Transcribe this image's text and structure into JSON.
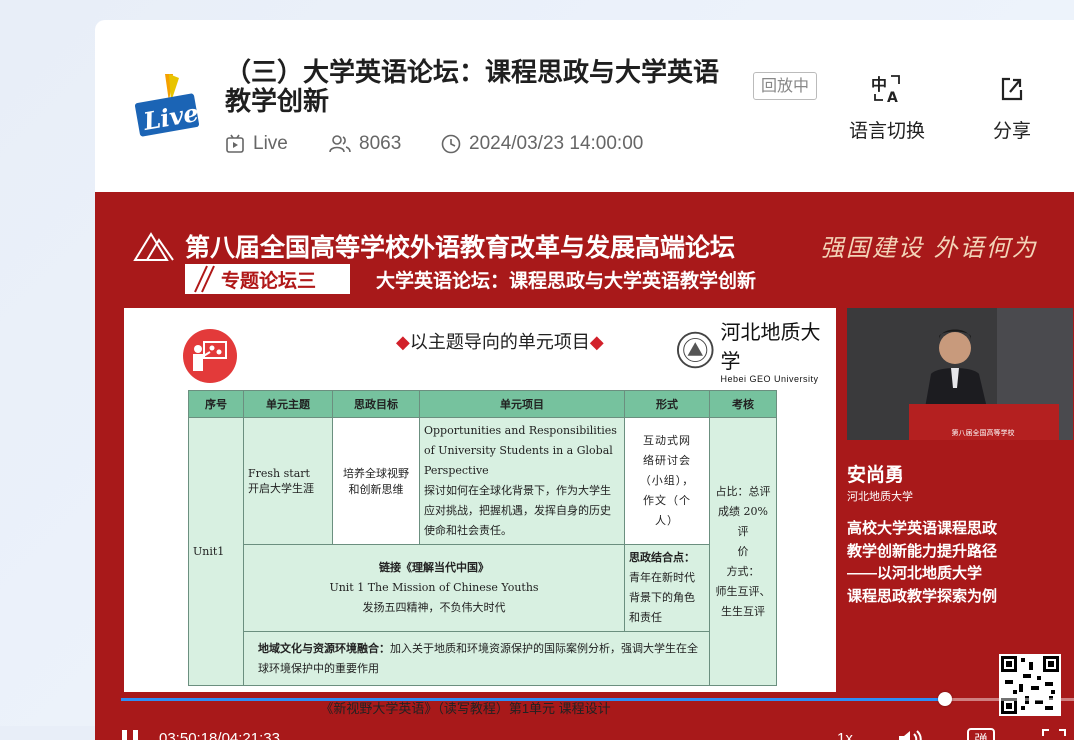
{
  "header": {
    "logo_text": "Live",
    "title": "（三）大学英语论坛：课程思政与大学英语教学创新",
    "status_badge": "回放中",
    "type_label": "Live",
    "viewers": "8063",
    "datetime": "2024/03/23 14:00:00",
    "tools": [
      {
        "label": "语言切换",
        "icon": "language-switch-icon"
      },
      {
        "label": "分享",
        "icon": "share-icon"
      }
    ]
  },
  "video": {
    "forum_title": "第八届全国高等学校外语教育改革与发展高端论坛",
    "slogan": "强国建设  外语何为",
    "session_tag": "专题论坛三",
    "session_title": "大学英语论坛：课程思政与大学英语教学创新",
    "slide": {
      "heading": "以主题导向的单元项目",
      "university_cn": "河北地质大学",
      "university_en": "Hebei GEO University",
      "table": {
        "headers": [
          "序号",
          "单元主题",
          "思政目标",
          "单元项目",
          "形式",
          "考核"
        ],
        "unit": "Unit1",
        "theme": [
          "Fresh start",
          "开启大学生涯"
        ],
        "goal": [
          "培养全球视野",
          "和创新思维"
        ],
        "project_en": "Opportunities and Responsibilities of University Students in a Global Perspective",
        "project_cn": "探讨如何在全球化背景下，作为大学生应对挑战，把握机遇，发挥自身的历史使命和社会责任。",
        "form": [
          "互动式网",
          "络研讨会",
          "（小组），",
          "作文（个",
          "人）"
        ],
        "assessment": [
          "占比：总评",
          "成绩 20%评",
          "价",
          "方式：",
          "师生互评、",
          "生生互评"
        ],
        "link_title": "链接《理解当代中国》",
        "link_en": "Unit 1 The Mission of Chinese Youths",
        "link_cn": "发扬五四精神，不负伟大时代",
        "combo_label": "思政结合点：",
        "combo_text": "青年在新时代背景下的角色和责任",
        "region_label": "地域文化与资源环境融合：",
        "region_text": "加入关于地质和环境资源保护的国际案例分析，强调大学生在全球环境保护中的重要作用"
      },
      "caption": "《新视野大学英语》（读写教程）第1单元 课程设计"
    },
    "speaker": {
      "podium_text": "第八届全国高等学校",
      "name": "安尚勇",
      "affiliation": "河北地质大学",
      "topic": [
        "高校大学英语课程思政",
        "教学创新能力提升路径",
        "——以河北地质大学",
        "课程思政教学探索为例"
      ]
    },
    "player": {
      "current_time": "03:50:18",
      "total_time": "04:21:33",
      "progress": 0.8545,
      "speed": "1x",
      "danmaku_label": "弹"
    }
  },
  "colors": {
    "video_bg": "#a8191a",
    "progress": "#2f8ef5",
    "table_header": "#76c29e",
    "table_cell": "#d8f0e1"
  }
}
